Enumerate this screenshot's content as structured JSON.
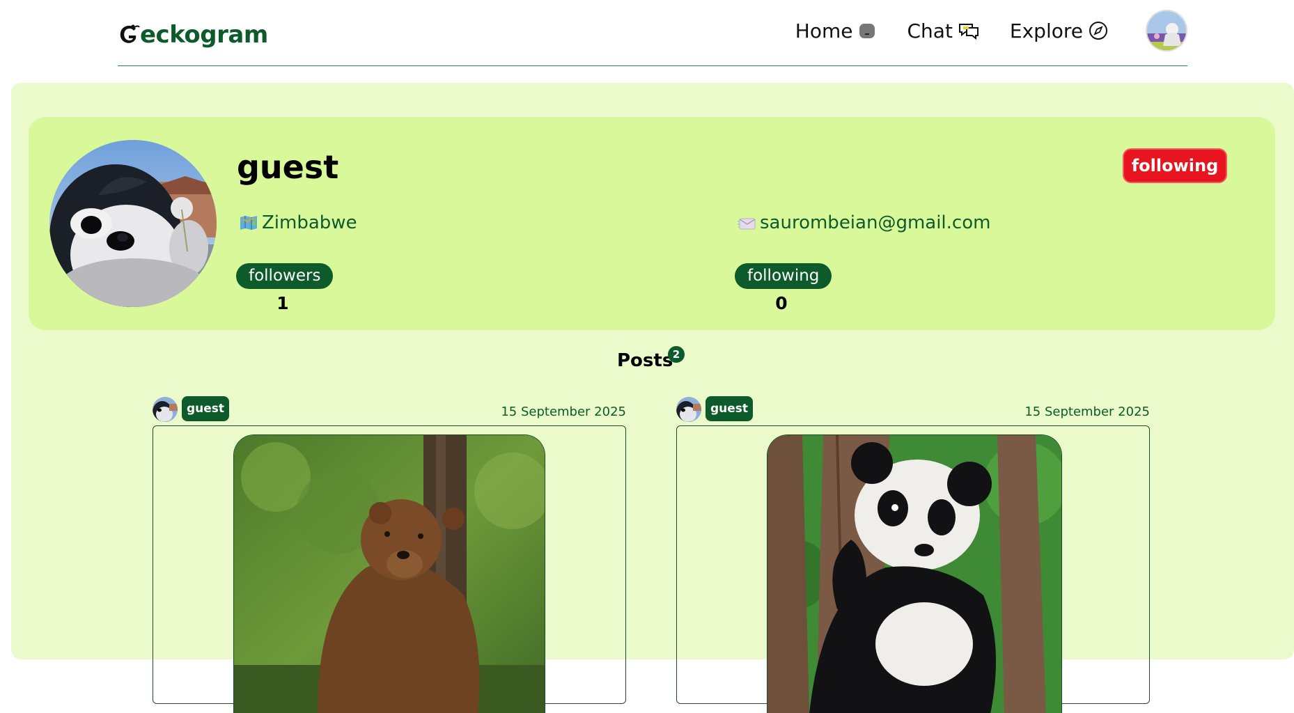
{
  "app": {
    "logo_text": "eckogram",
    "logo_icon": "gecko-g-icon"
  },
  "nav": {
    "items": [
      {
        "label": "Home",
        "icon": "home-icon"
      },
      {
        "label": "Chat",
        "icon": "chat-icon"
      },
      {
        "label": "Explore",
        "icon": "compass-icon"
      }
    ],
    "avatar_icon": "user-avatar"
  },
  "profile": {
    "username": "guest",
    "follow_button": "following",
    "country": "Zimbabwe",
    "country_icon": "map-icon",
    "email": "saurombeian@gmail.com",
    "email_icon": "envelope-icon",
    "followers_label": "followers",
    "followers_count": "1",
    "following_label": "following",
    "following_count": "0"
  },
  "posts_section": {
    "title": "Posts",
    "count": "2"
  },
  "posts": [
    {
      "user": "guest",
      "date": "15 September 2025",
      "image": "brown bear in forest"
    },
    {
      "user": "guest",
      "date": "15 September 2025",
      "image": "panda in tree"
    }
  ],
  "colors": {
    "brand_green": "#0d5a2a",
    "panel_bg": "#ebfaca",
    "card_bg": "#d8f89a",
    "follow_red": "#e8141f"
  }
}
